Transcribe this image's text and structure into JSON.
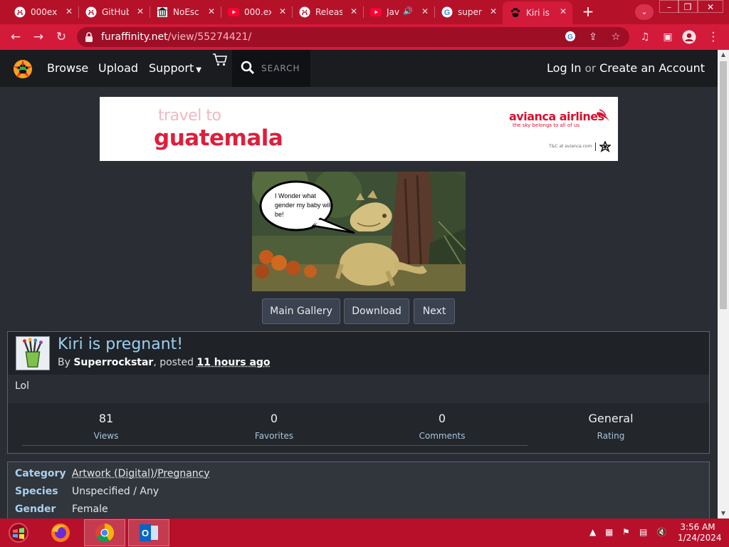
{
  "browser": {
    "tabs": [
      {
        "title": "000ex",
        "icon": "github-icon"
      },
      {
        "title": "GitHub",
        "icon": "github-icon"
      },
      {
        "title": "NoEsc",
        "icon": "museum-icon"
      },
      {
        "title": "000.ex",
        "icon": "youtube-icon"
      },
      {
        "title": "Releas",
        "icon": "github-icon"
      },
      {
        "title": "Jav",
        "icon": "youtube-icon"
      },
      {
        "title": "super",
        "icon": "google-icon"
      },
      {
        "title": "Kiri is",
        "icon": "furaffinity-icon",
        "active": true
      }
    ],
    "url_host": "furaffinity.net",
    "url_path": "/view/55274421/"
  },
  "site": {
    "nav": {
      "browse": "Browse",
      "upload": "Upload",
      "support": "Support"
    },
    "search_label": "SEARCH",
    "login": "Log In",
    "or": "or",
    "create_account": "Create an Account"
  },
  "ad": {
    "line1": "travel to",
    "line2": "guatemala",
    "brand": "avianca airlines",
    "tagline": "the sky belongs to all of us",
    "terms": "T&C at avianca.com"
  },
  "artwork": {
    "bubble_text": "I Wonder what gender my baby will be!"
  },
  "buttons": {
    "main_gallery": "Main Gallery",
    "download": "Download",
    "next": "Next"
  },
  "submission": {
    "title": "Kiri is pregnant!",
    "by": "By",
    "author": "Superrockstar",
    "posted": ", posted",
    "time": "11 hours ago",
    "description": "Lol",
    "stats": [
      {
        "value": "81",
        "label": "Views"
      },
      {
        "value": "0",
        "label": "Favorites"
      },
      {
        "value": "0",
        "label": "Comments"
      },
      {
        "value": "General",
        "label": "Rating"
      }
    ]
  },
  "info": {
    "category_label": "Category",
    "category_a": "Artwork (Digital)",
    "category_sep": "/",
    "category_b": "Pregnancy",
    "species_label": "Species",
    "species": "Unspecified / Any",
    "gender_label": "Gender",
    "gender": "Female"
  },
  "taskbar": {
    "time": "3:56 AM",
    "date": "1/24/2024"
  }
}
